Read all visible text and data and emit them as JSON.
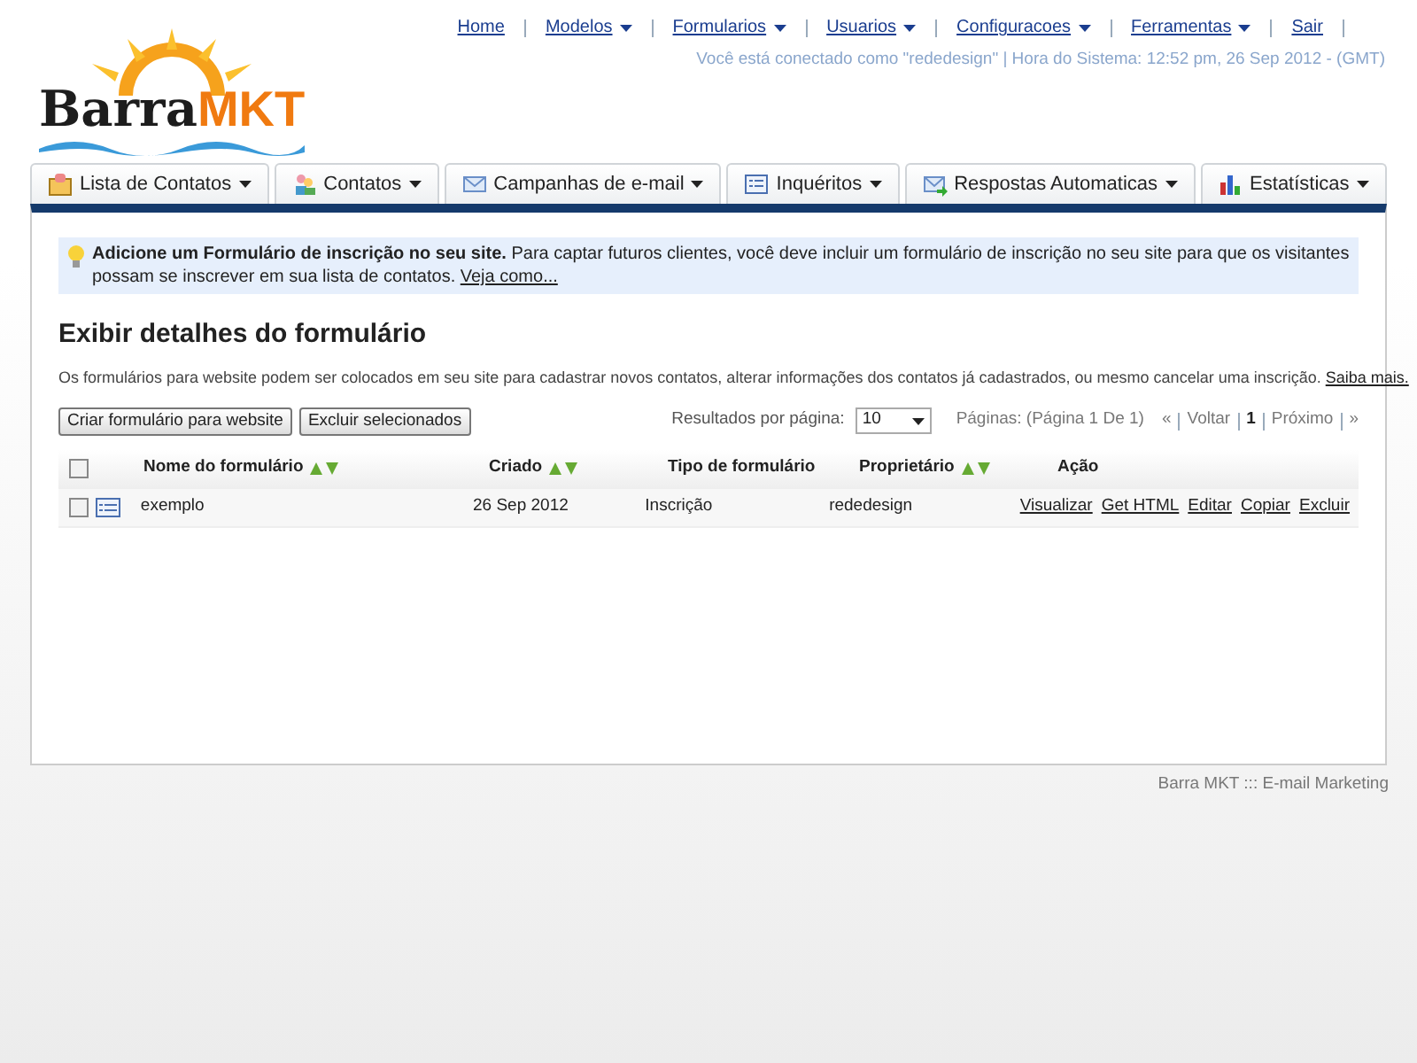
{
  "top_nav": {
    "items": [
      {
        "label": "Home",
        "dropdown": false
      },
      {
        "label": "Modelos",
        "dropdown": true
      },
      {
        "label": "Formularios",
        "dropdown": true
      },
      {
        "label": "Usuarios",
        "dropdown": true
      },
      {
        "label": "Configuracoes",
        "dropdown": true
      },
      {
        "label": "Ferramentas",
        "dropdown": true
      },
      {
        "label": "Sair",
        "dropdown": false
      }
    ],
    "status": "Você está conectado como \"rededesign\" | Hora do Sistema: 12:52 pm, 26 Sep 2012 - (GMT)"
  },
  "logo": {
    "part_1": "Barra",
    "part_2": "MKT"
  },
  "tabs": [
    {
      "label": "Lista de Contatos",
      "kind": "list"
    },
    {
      "label": "Contatos",
      "kind": "people"
    },
    {
      "label": "Campanhas de e-mail",
      "kind": "mail"
    },
    {
      "label": "Inquéritos",
      "kind": "form"
    },
    {
      "label": "Respostas Automaticas",
      "kind": "automail"
    },
    {
      "label": "Estatísticas",
      "kind": "chart"
    }
  ],
  "notice": {
    "text": "**Adicione um Formulário de inscrição no seu site.** Para captar futuros clientes, você deve incluir um formulário de inscrição no seu site para que os visitantes possam se inscrever em sua lista de contatos.",
    "link": "Veja como..."
  },
  "page": {
    "title": "Exibir detalhes do formulário",
    "description": "Os formulários para website podem ser colocados em seu site para cadastrar novos contatos, alterar informações dos contatos já cadastrados, ou mesmo cancelar uma inscrição.",
    "link": "Saiba mais."
  },
  "toolbar": {
    "buttons": [
      "Criar formulário para website",
      "Excluir selecionados"
    ],
    "per_page_label": "Resultados por página:",
    "per_page_value": "10",
    "pages_label": "Páginas: (Página 1 De 1)",
    "pager": [
      {
        "label": "«",
        "current": false
      },
      {
        "label": "Voltar",
        "current": false
      },
      {
        "label": "1",
        "current": true
      },
      {
        "label": "Próximo",
        "current": false
      },
      {
        "label": "»",
        "current": false
      }
    ]
  },
  "table": {
    "header_checked": false,
    "columns": [
      {
        "label": "Nome do formulário",
        "sortable": true
      },
      {
        "label": "Criado",
        "sortable": true
      },
      {
        "label": "Tipo de formulário",
        "sortable": false
      },
      {
        "label": "Proprietário",
        "sortable": true
      },
      {
        "label": "Ação",
        "sortable": false
      }
    ],
    "rows": [
      {
        "checked": false,
        "name": "exemplo",
        "created": "26 Sep 2012",
        "type": "Inscrição",
        "owner": "rededesign",
        "actions": [
          "Visualizar",
          "Get HTML",
          "Editar",
          "Copiar",
          "Excluir"
        ]
      }
    ]
  },
  "footer": "Barra MKT ::: E-mail Marketing"
}
